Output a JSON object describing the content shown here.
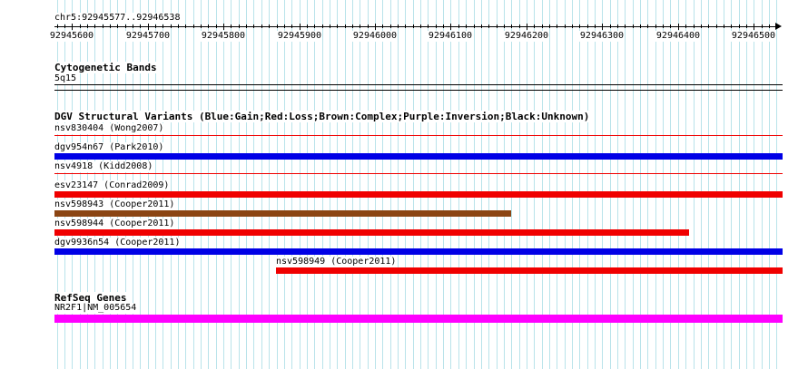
{
  "colors": {
    "grid": "#b9e3ea",
    "gain": "#0000e6",
    "loss": "#f00000",
    "complex": "#8b4513",
    "gene": "#ff00ff"
  },
  "view": {
    "start": 92945577,
    "end": 92946538
  },
  "location": "chr5:92945577..92946538",
  "ruler": {
    "ticks": [
      92945600,
      92945700,
      92945800,
      92945900,
      92946000,
      92946100,
      92946200,
      92946300,
      92946400,
      92946500
    ],
    "labels": [
      "92945600",
      "92945700",
      "92945800",
      "92945900",
      "92946000",
      "92946100",
      "92946200",
      "92946300",
      "92946400",
      "92946500"
    ]
  },
  "tracks": {
    "cytoband": {
      "title": "Cytogenetic Bands",
      "band_label": "5q15"
    },
    "dgv": {
      "title": "DGV Structural Variants (Blue:Gain;Red:Loss;Brown:Complex;Purple:Inversion;Black:Unknown)",
      "features": [
        {
          "label": "nsv830404 (Wong2007)",
          "type": "loss",
          "start": 92945577,
          "end": 92946538,
          "thin": true
        },
        {
          "label": "dgv954n67 (Park2010)",
          "type": "gain",
          "start": 92945577,
          "end": 92946538,
          "thin": false
        },
        {
          "label": "nsv4918 (Kidd2008)",
          "type": "loss",
          "start": 92945577,
          "end": 92946538,
          "thin": true
        },
        {
          "label": "esv23147 (Conrad2009)",
          "type": "loss",
          "start": 92945577,
          "end": 92946538,
          "thin": false
        },
        {
          "label": "nsv598943 (Cooper2011)",
          "type": "complex",
          "start": 92945577,
          "end": 92946180,
          "thin": false
        },
        {
          "label": "nsv598944 (Cooper2011)",
          "type": "loss",
          "start": 92945577,
          "end": 92946414,
          "thin": false
        },
        {
          "label": "dgv9936n54 (Cooper2011)",
          "type": "gain",
          "start": 92945577,
          "end": 92946538,
          "thin": false
        },
        {
          "label": "nsv598949 (Cooper2011)",
          "type": "loss",
          "start": 92945869,
          "end": 92946538,
          "thin": false
        }
      ]
    },
    "refseq": {
      "title": "RefSeq Genes",
      "gene_label": "NR2F1|NM_005654",
      "start": 92945577,
      "end": 92946538
    }
  }
}
